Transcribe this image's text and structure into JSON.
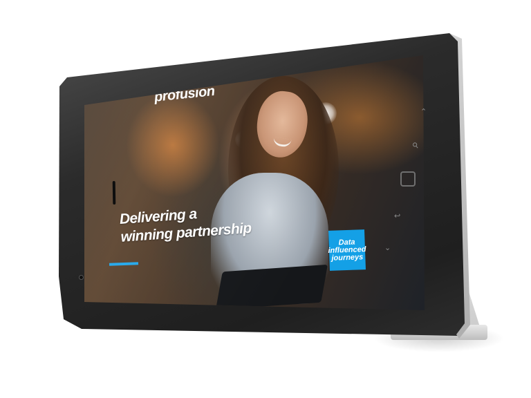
{
  "screen": {
    "logo": "profusion",
    "headline_line1": "Delivering a",
    "headline_line2": "winning partnership",
    "badge_line1": "Data",
    "badge_line2": "influenced",
    "badge_line3": "journeys"
  },
  "hardware": {
    "up_icon": "chevron-up-icon",
    "key_icon": "key-icon",
    "down_icon": "chevron-down-icon",
    "back_icon": "back-icon"
  },
  "colors": {
    "accent": "#14a0e6",
    "bezel": "#1f1f1f",
    "cover": "#d4d4d4"
  }
}
